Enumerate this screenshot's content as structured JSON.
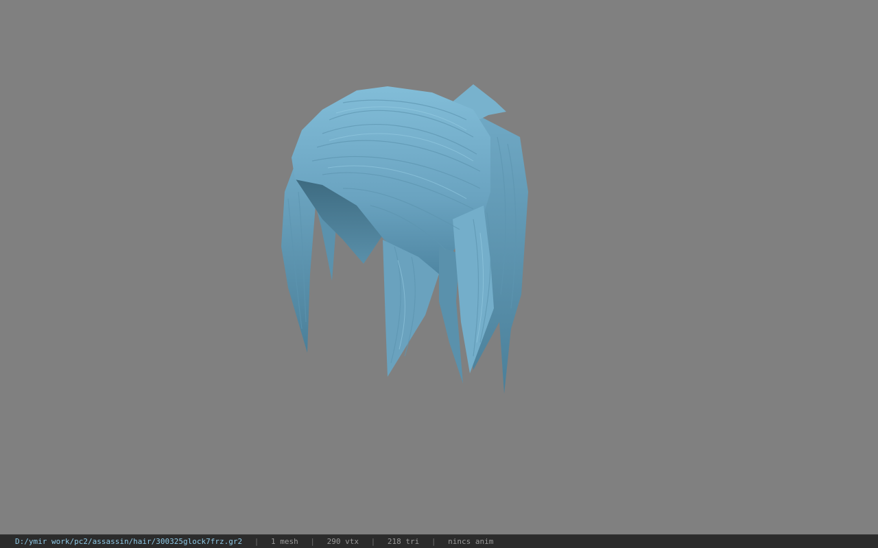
{
  "viewer": {
    "background_color": "#808080",
    "model": {
      "description_icon": "hair-mesh-icon",
      "base_color": "#6fa7c3",
      "highlight_color": "#8cc4dc",
      "shadow_color": "#3f6c82"
    }
  },
  "statusbar": {
    "file_path": "D:/ymir work/pc2/assassin/hair/300325glock7frz.gr2",
    "mesh_count": "1 mesh",
    "vertex_count": "290 vtx",
    "triangle_count": "218 tri",
    "anim_info": "nincs anim",
    "separator": "|"
  }
}
